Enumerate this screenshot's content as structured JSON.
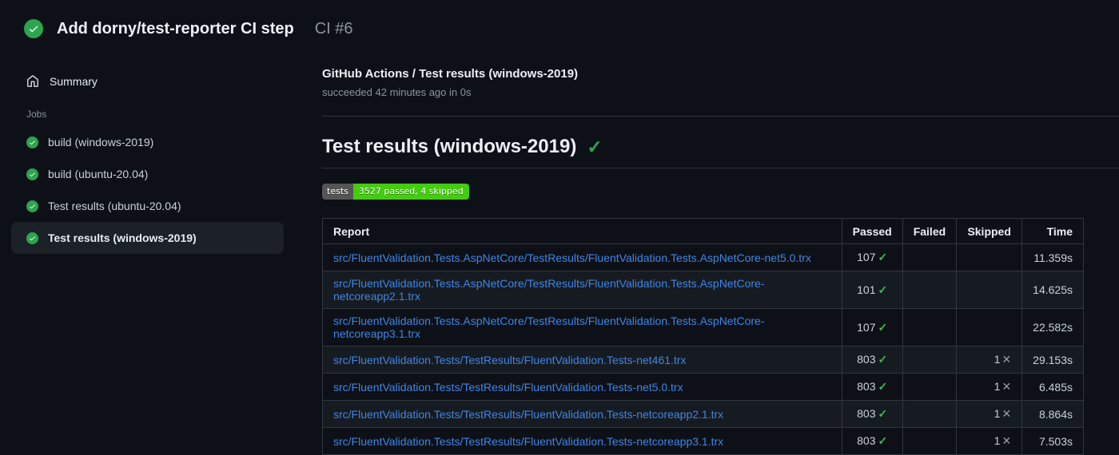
{
  "icons": {
    "check": "✓",
    "cross": "✕"
  },
  "colors": {
    "page_bg": "#0d1117",
    "success_circle_green": "#2ea44f",
    "check_green": "#3fb950",
    "link_blue": "#4184e4",
    "muted_gray": "#8b949e",
    "table_border": "#30363d",
    "selected_item_bg": "#1c2128",
    "badge_label_bg": "#555555",
    "badge_value_bg": "#44cc11"
  },
  "header": {
    "title": "Add dorny/test-reporter CI step",
    "run_number": "CI #6"
  },
  "sidebar": {
    "summary_label": "Summary",
    "jobs_label": "Jobs",
    "jobs": [
      {
        "label": "build (windows-2019)",
        "selected": false
      },
      {
        "label": "build (ubuntu-20.04)",
        "selected": false
      },
      {
        "label": "Test results (ubuntu-20.04)",
        "selected": false
      },
      {
        "label": "Test results (windows-2019)",
        "selected": true
      }
    ]
  },
  "main": {
    "check_title": "GitHub Actions / Test results (windows-2019)",
    "check_status": "succeeded 42 minutes ago in 0s",
    "heading": "Test results (windows-2019)",
    "badge": {
      "label": "tests",
      "value": "3527 passed, 4 skipped"
    },
    "table": {
      "headers": [
        "Report",
        "Passed",
        "Failed",
        "Skipped",
        "Time"
      ],
      "rows": [
        {
          "report": "src/FluentValidation.Tests.AspNetCore/TestResults/FluentValidation.Tests.AspNetCore-net5.0.trx",
          "passed": "107",
          "failed": "",
          "skipped": "",
          "time": "11.359s"
        },
        {
          "report": "src/FluentValidation.Tests.AspNetCore/TestResults/FluentValidation.Tests.AspNetCore-netcoreapp2.1.trx",
          "passed": "101",
          "failed": "",
          "skipped": "",
          "time": "14.625s"
        },
        {
          "report": "src/FluentValidation.Tests.AspNetCore/TestResults/FluentValidation.Tests.AspNetCore-netcoreapp3.1.trx",
          "passed": "107",
          "failed": "",
          "skipped": "",
          "time": "22.582s"
        },
        {
          "report": "src/FluentValidation.Tests/TestResults/FluentValidation.Tests-net461.trx",
          "passed": "803",
          "failed": "",
          "skipped": "1",
          "time": "29.153s"
        },
        {
          "report": "src/FluentValidation.Tests/TestResults/FluentValidation.Tests-net5.0.trx",
          "passed": "803",
          "failed": "",
          "skipped": "1",
          "time": "6.485s"
        },
        {
          "report": "src/FluentValidation.Tests/TestResults/FluentValidation.Tests-netcoreapp2.1.trx",
          "passed": "803",
          "failed": "",
          "skipped": "1",
          "time": "8.864s"
        },
        {
          "report": "src/FluentValidation.Tests/TestResults/FluentValidation.Tests-netcoreapp3.1.trx",
          "passed": "803",
          "failed": "",
          "skipped": "1",
          "time": "7.503s"
        }
      ]
    }
  }
}
